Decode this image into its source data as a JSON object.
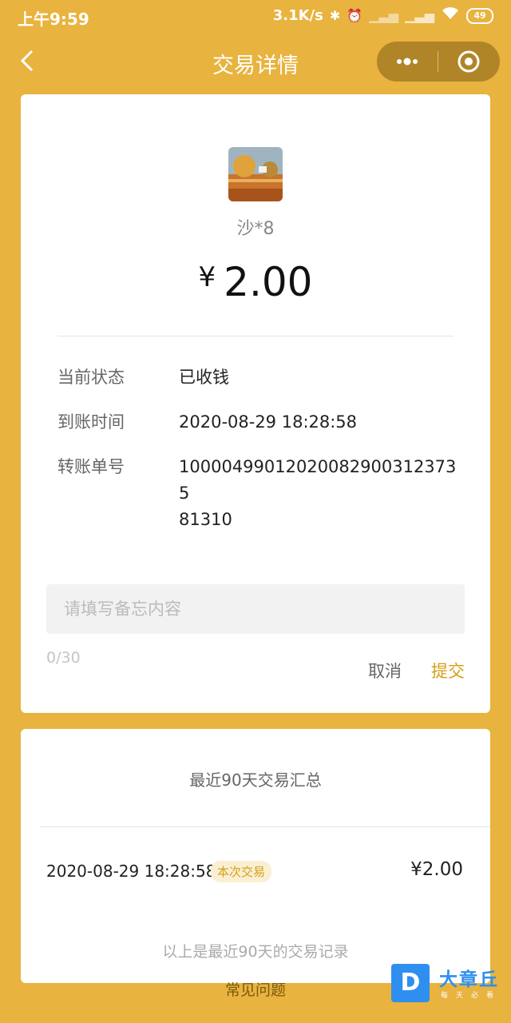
{
  "status_bar": {
    "time": "上午9:59",
    "speed": "3.1K/s",
    "battery": "49"
  },
  "nav": {
    "title": "交易详情"
  },
  "transaction": {
    "payer": "沙*8",
    "currency": "¥",
    "amount": "2.00",
    "fields": [
      {
        "label": "当前状态",
        "value": "已收钱"
      },
      {
        "label": "到账时间",
        "value": "2020-08-29 18:28:58"
      },
      {
        "label": "转账单号",
        "value": "100004990120200829003123735\n81310"
      }
    ]
  },
  "memo": {
    "placeholder": "请填写备忘内容",
    "counter": "0/30",
    "cancel_label": "取消",
    "submit_label": "提交"
  },
  "summary": {
    "title": "最近90天交易汇总",
    "records": [
      {
        "time": "2020-08-29 18:28:58",
        "badge": "本次交易",
        "amount": "¥2.00"
      }
    ],
    "footer_note": "以上是最近90天的交易记录"
  },
  "faq_label": "常见问题",
  "watermark": {
    "logo_letter": "D",
    "brand": "大章丘",
    "tagline": "每天必看"
  },
  "colors": {
    "background": "#E8B33E",
    "accent": "#D4A017"
  }
}
